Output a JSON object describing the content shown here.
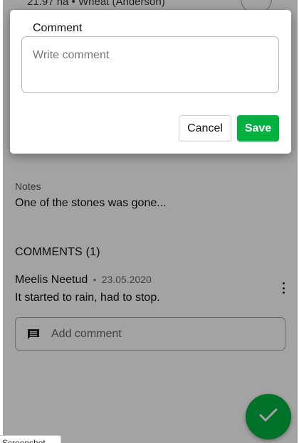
{
  "background": {
    "field_summary": "21.97 ha • Wheat (Anderson)",
    "hidden_text": "",
    "notes": {
      "label": "Notes",
      "value": "One of the stones was gone..."
    },
    "comments": {
      "heading": "COMMENTS (1)",
      "items": [
        {
          "author": "Meelis Neetud",
          "separator": "•",
          "date": "23.05.2020",
          "text": "It started to rain, had to stop."
        }
      ],
      "add_label": "Add comment",
      "add_icon": "comment-icon"
    },
    "fab_icon": "check-icon"
  },
  "dialog": {
    "title": "Comment",
    "placeholder": "Write comment",
    "value": "",
    "cancel_label": "Cancel",
    "save_label": "Save"
  },
  "tooltip": {
    "label": "Screenshot"
  },
  "colors": {
    "accent": "#00b140",
    "overlay": "rgba(0,0,0,0.36)"
  }
}
